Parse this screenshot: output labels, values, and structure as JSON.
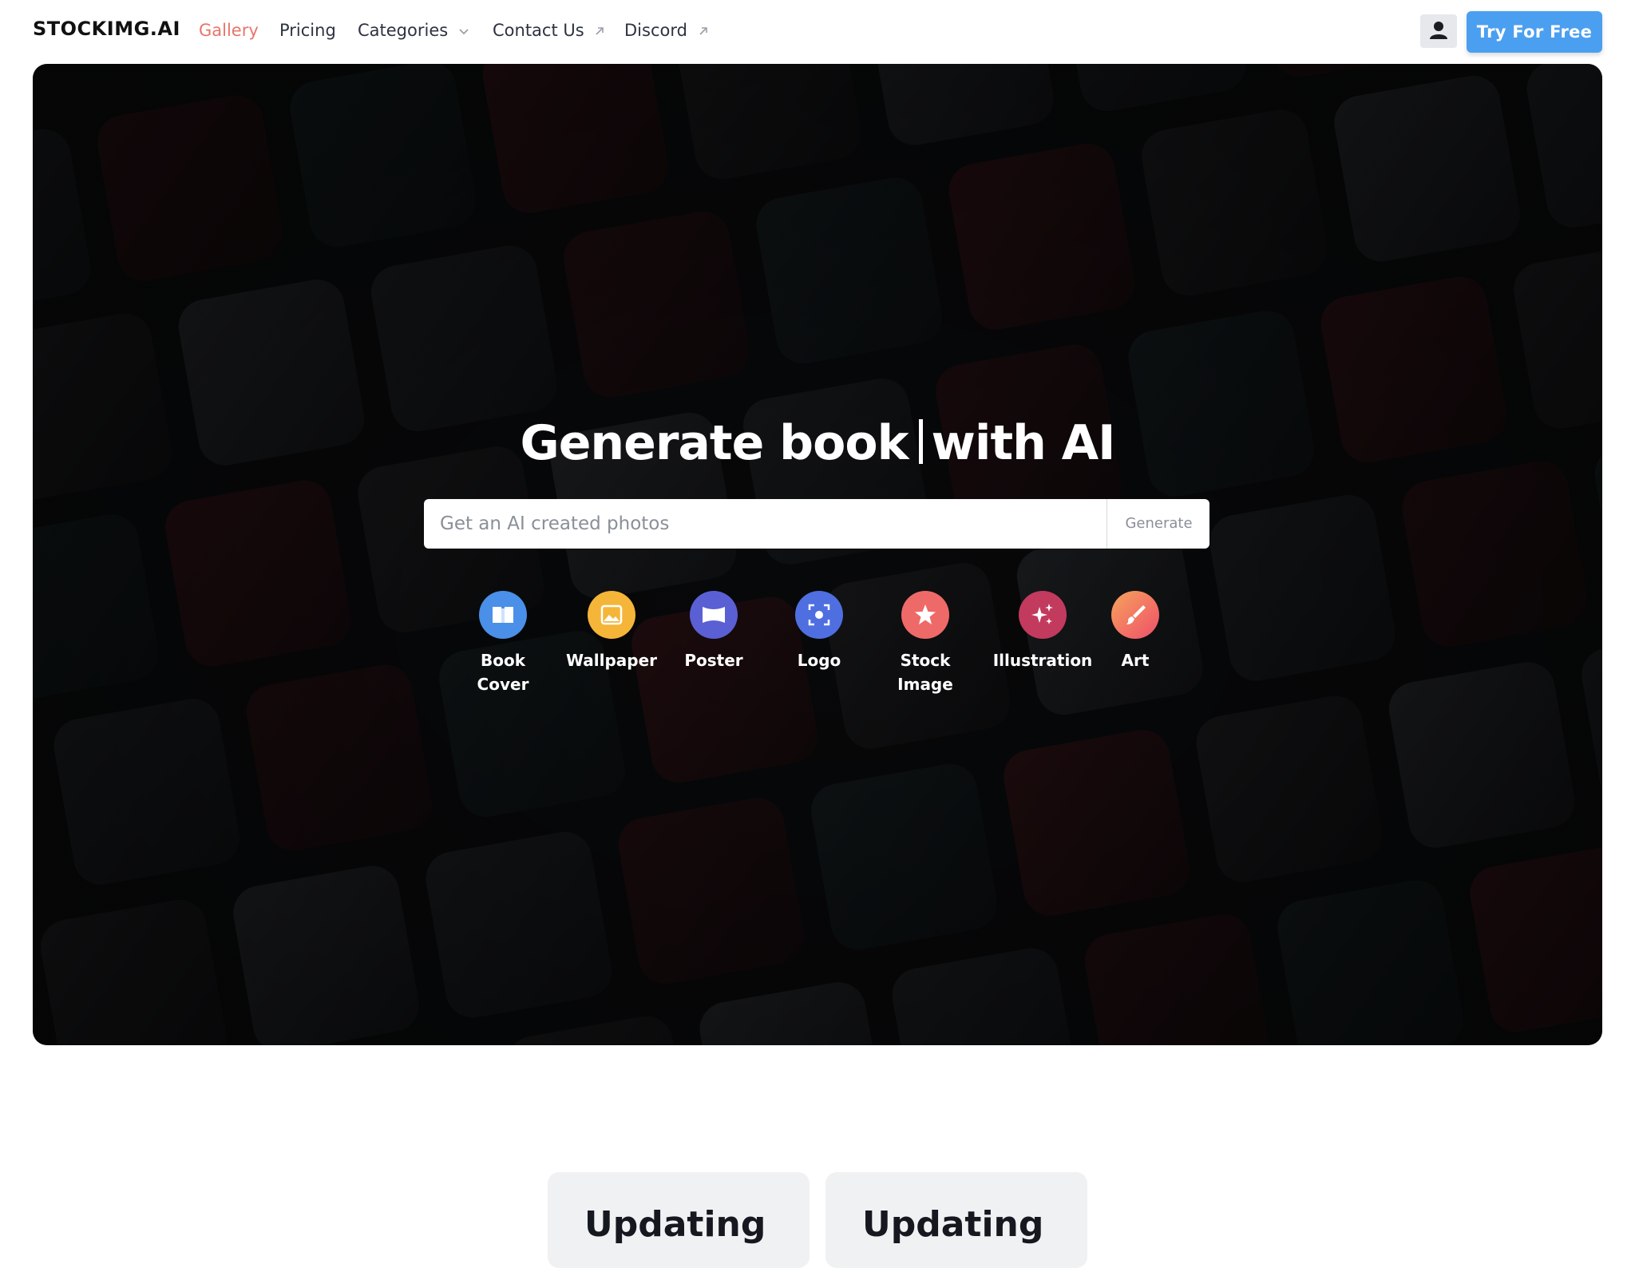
{
  "nav": {
    "brand": "STOCKIMG.AI",
    "links": [
      {
        "label": "Gallery",
        "active": true
      },
      {
        "label": "Pricing"
      },
      {
        "label": "Categories",
        "suffix_icon": "chevron-down-icon"
      },
      {
        "label": "Contact Us",
        "suffix_icon": "external-arrow-icon"
      },
      {
        "label": "Discord",
        "suffix_icon": "external-arrow-icon"
      }
    ],
    "user_icon": "user-icon",
    "cta": "Try For Free"
  },
  "hero": {
    "headline_prefix": "Generate book",
    "headline_suffix": "with AI",
    "search_placeholder": "Get an AI created photos",
    "search_value": "",
    "generate_label": "Generate",
    "categories": [
      {
        "line1": "Book",
        "line2": "Cover",
        "icon": "book-icon",
        "color": "#4a8fe8"
      },
      {
        "line1": "Wallpaper",
        "line2": "",
        "icon": "image-icon",
        "color": "#f5b538"
      },
      {
        "line1": "Poster",
        "line2": "",
        "icon": "poster-icon",
        "color": "#5a5fd4"
      },
      {
        "line1": "Logo",
        "line2": "",
        "icon": "focus-icon",
        "color": "#4f6fe0"
      },
      {
        "line1": "Stock",
        "line2": "Image",
        "icon": "star-icon",
        "color": "#ee6a68"
      },
      {
        "line1": "Illustration",
        "line2": "",
        "icon": "sparkle-icon",
        "color": "#c23a5e"
      },
      {
        "line1": "Art",
        "line2": "",
        "icon": "brush-icon",
        "color": "#f47a5a"
      }
    ]
  },
  "cards": [
    {
      "title": "Updating"
    },
    {
      "title": "Updating"
    }
  ],
  "colors": {
    "accent": "#4b9ff0",
    "active_link": "#e8756b",
    "hero_bg": "#0b0c0e"
  }
}
